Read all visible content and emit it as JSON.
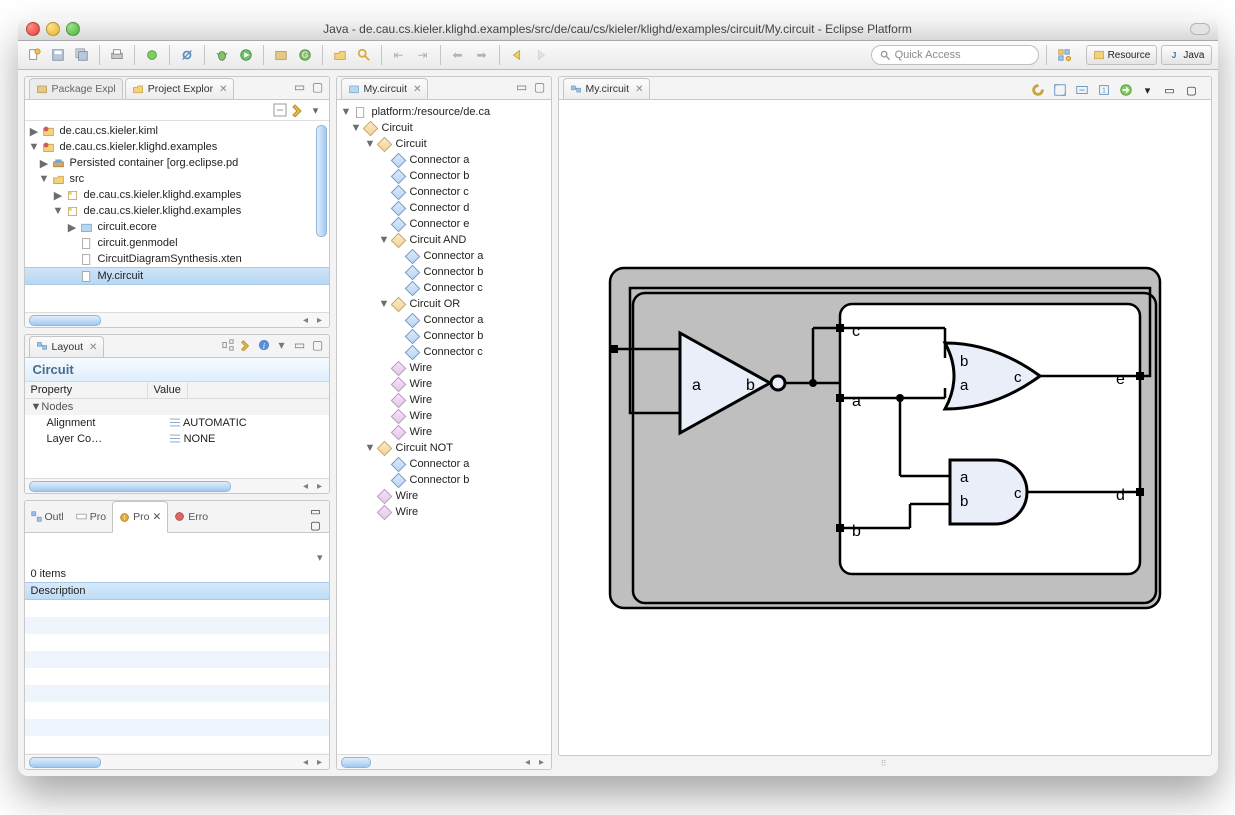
{
  "window": {
    "title": "Java - de.cau.cs.kieler.klighd.examples/src/de/cau/cs/kieler/klighd/examples/circuit/My.circuit - Eclipse Platform"
  },
  "toolbar": {
    "quick_access_placeholder": "Quick Access",
    "perspectives": {
      "resource": "Resource",
      "java": "Java"
    }
  },
  "left": {
    "tabs": {
      "package_explorer": "Package Expl",
      "project_explorer": "Project Explor"
    },
    "tree": {
      "n0": "de.cau.cs.kieler.kiml",
      "n1": "de.cau.cs.kieler.klighd.examples",
      "n2": "Persisted container [org.eclipse.pd",
      "n3": "src",
      "n4": "de.cau.cs.kieler.klighd.examples",
      "n5": "de.cau.cs.kieler.klighd.examples",
      "n6": "circuit.ecore",
      "n7": "circuit.genmodel",
      "n8": "CircuitDiagramSynthesis.xten",
      "n9": "My.circuit"
    }
  },
  "layout": {
    "tab": "Layout",
    "header": "Circuit",
    "cols": {
      "prop": "Property",
      "val": "Value"
    },
    "group": "Nodes",
    "rows": {
      "alignment_k": "Alignment",
      "alignment_v": "AUTOMATIC",
      "layer_k": "Layer Co…",
      "layer_v": "NONE"
    }
  },
  "problems": {
    "tabs": {
      "outl": "Outl",
      "pro1": "Pro",
      "pro2": "Pro",
      "erro": "Erro"
    },
    "items_label": "0 items",
    "col_description": "Description"
  },
  "outline": {
    "tab": "My.circuit",
    "root": "platform:/resource/de.ca",
    "nodes": {
      "circuit1": "Circuit",
      "circuit2": "Circuit",
      "conn_a": "Connector a",
      "conn_b": "Connector b",
      "conn_c": "Connector c",
      "conn_d": "Connector d",
      "conn_e": "Connector e",
      "and": "Circuit AND",
      "and_a": "Connector a",
      "and_b": "Connector b",
      "and_c": "Connector c",
      "or": "Circuit OR",
      "or_a": "Connector a",
      "or_b": "Connector b",
      "or_c": "Connector c",
      "wire1": "Wire",
      "wire2": "Wire",
      "wire3": "Wire",
      "wire4": "Wire",
      "wire5": "Wire",
      "not": "Circuit NOT",
      "not_a": "Connector a",
      "not_b": "Connector b",
      "wire6": "Wire",
      "wire7": "Wire"
    }
  },
  "diagram": {
    "tab": "My.circuit",
    "ports": {
      "a": "a",
      "b": "b",
      "c": "c",
      "d": "d",
      "e": "e"
    }
  }
}
